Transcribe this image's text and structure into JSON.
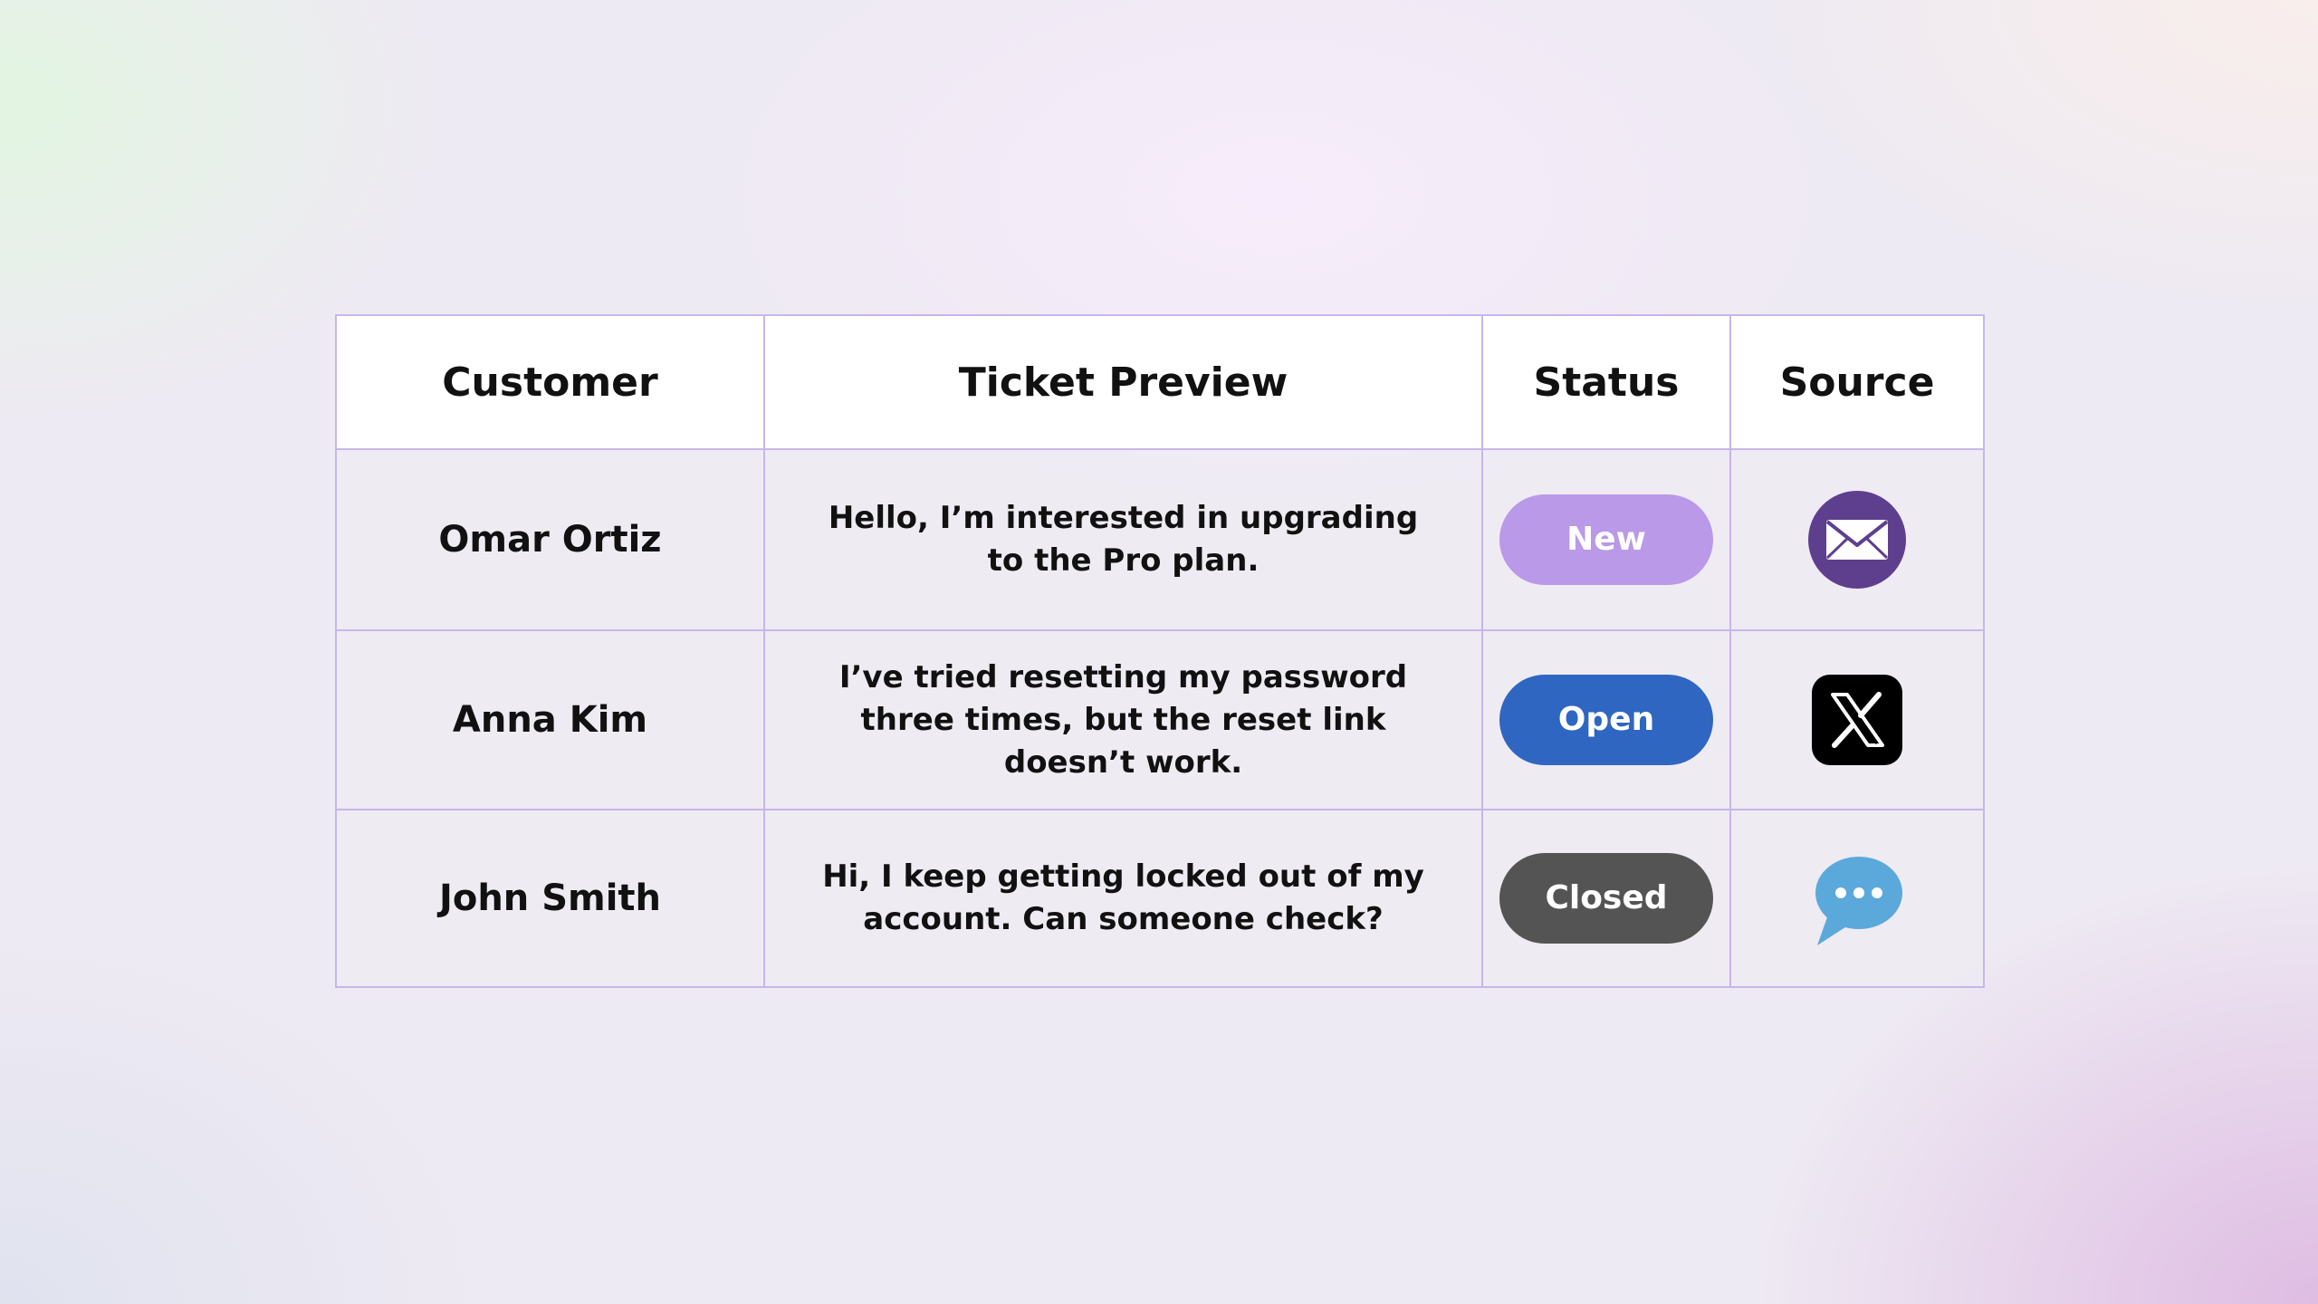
{
  "table": {
    "headers": {
      "customer": "Customer",
      "preview": "Ticket Preview",
      "status": "Status",
      "source": "Source"
    },
    "rows": [
      {
        "customer": "Omar Ortiz",
        "preview": "Hello, I’m interested in upgrading to the Pro plan.",
        "status": "New",
        "status_color": "#b999e8",
        "source_icon": "email-icon",
        "source_color": "#5e3f8e"
      },
      {
        "customer": "Anna Kim",
        "preview": "I’ve tried resetting my password three times, but the reset link doesn’t work.",
        "status": "Open",
        "status_color": "#2f66c2",
        "source_icon": "x-logo-icon",
        "source_color": "#000000"
      },
      {
        "customer": "John Smith",
        "preview": "Hi, I keep getting locked out of my account. Can someone check?",
        "status": "Closed",
        "status_color": "#545454",
        "source_icon": "chat-bubble-icon",
        "source_color": "#5ba9db"
      }
    ]
  },
  "colors": {
    "grid_border": "#c7b6ea",
    "header_background": "#ffffff",
    "text": "#111111"
  }
}
